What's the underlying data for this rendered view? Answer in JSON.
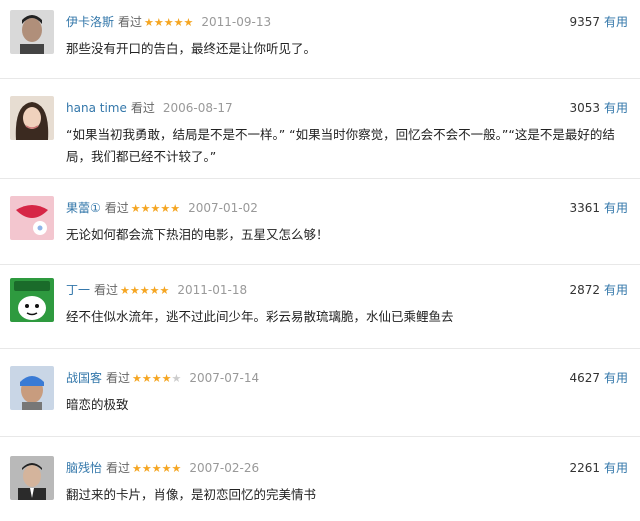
{
  "review_list": {
    "seen_label": "看过",
    "useful_label": "有用",
    "reviews": [
      {
        "user": "伊卡洛斯",
        "rating": 5,
        "date": "2011-09-13",
        "votes": "9357",
        "comment": "那些没有开口的告白，最终还是让你听见了。",
        "avatar": "portrait-male-icon"
      },
      {
        "user": "hana time",
        "rating": 0,
        "date": "2006-08-17",
        "votes": "3053",
        "comment": "“如果当初我勇敢，结局是不是不一样。”      “如果当时你察觉，回忆会不会不一般。”“这是不是最好的结局，我们都已经不计较了。”",
        "avatar": "portrait-female-icon"
      },
      {
        "user": "果蕾①",
        "rating": 5,
        "date": "2007-01-02",
        "votes": "3361",
        "comment": "无论如何都会流下热泪的电影，五星又怎么够！",
        "avatar": "lips-flower-icon"
      },
      {
        "user": "丁一",
        "rating": 5,
        "date": "2011-01-18",
        "votes": "2872",
        "comment": "经不住似水流年，逃不过此间少年。彩云易散琉璃脆，水仙已乘鲤鱼去",
        "avatar": "cartoon-face-icon"
      },
      {
        "user": "战国客",
        "rating": 4,
        "date": "2007-07-14",
        "votes": "4627",
        "comment": "暗恋的极致",
        "avatar": "portrait-bandana-icon"
      },
      {
        "user": "脑残怡",
        "rating": 5,
        "date": "2007-02-26",
        "votes": "2261",
        "comment": "翻过来的卡片，肖像，是初恋回忆的完美情书",
        "avatar": "portrait-suit-icon"
      }
    ]
  },
  "colors": {
    "link": "#3377aa",
    "star": "#f5a623",
    "date": "#999999"
  }
}
